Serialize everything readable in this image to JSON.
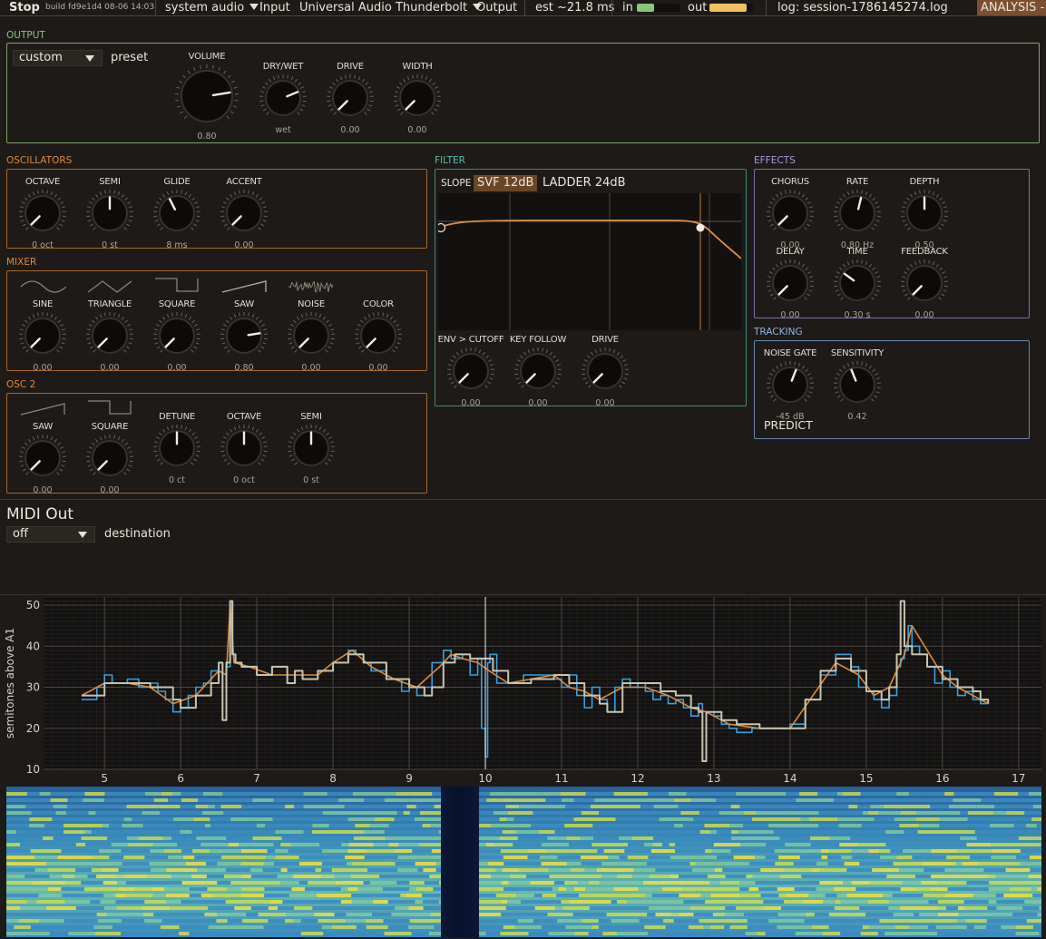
{
  "topbar": {
    "stop_label": "Stop",
    "build_text": "build fd9e1d4 08-06 14:03",
    "audio_source": "system audio",
    "input_label": "Input",
    "input_device": "Universal Audio Thunderbolt",
    "output_label": "Output",
    "latency": "est ~21.8 ms",
    "in_label": "in",
    "in_level": 0.4,
    "out_label": "out",
    "out_level": 0.85,
    "log_text": "log: session-1786145274.log",
    "analysis_label": "ANALYSIS -"
  },
  "colors": {
    "output_accent": "#8cc47c",
    "synth_accent": "#e08a3c",
    "filter_accent": "#4ec0b0",
    "effects_accent": "#a89ae0",
    "tracking_accent": "#8eb4e4",
    "pitch_raw": "#3aa0e0",
    "pitch_smooth": "#e08a3c",
    "pitch_quant": "#c8c4b0"
  },
  "output": {
    "title": "OUTPUT",
    "preset_value": "custom",
    "preset_label": "preset",
    "knobs": [
      {
        "label": "VOLUME",
        "value": "0.80",
        "level": 0.8
      },
      {
        "label": "DRY/WET",
        "value": "wet",
        "level": 0.75
      },
      {
        "label": "DRIVE",
        "value": "0.00",
        "level": 0.0
      },
      {
        "label": "WIDTH",
        "value": "0.00",
        "level": 0.0
      }
    ]
  },
  "oscillators": {
    "title": "OSCILLATORS",
    "knobs": [
      {
        "label": "OCTAVE",
        "value": "0 oct",
        "level": 0.0
      },
      {
        "label": "SEMI",
        "value": "0 st",
        "level": 0.5
      },
      {
        "label": "GLIDE",
        "value": "8 ms",
        "level": 0.4
      },
      {
        "label": "ACCENT",
        "value": "0.00",
        "level": 0.0
      }
    ]
  },
  "mixer": {
    "title": "MIXER",
    "knobs": [
      {
        "label": "SINE",
        "value": "0.00",
        "level": 0.0
      },
      {
        "label": "TRIANGLE",
        "value": "0.00",
        "level": 0.0
      },
      {
        "label": "SQUARE",
        "value": "0.00",
        "level": 0.0
      },
      {
        "label": "SAW",
        "value": "0.80",
        "level": 0.8
      },
      {
        "label": "NOISE",
        "value": "0.00",
        "level": 0.0
      },
      {
        "label": "COLOR",
        "value": "0.00",
        "level": 0.0
      }
    ]
  },
  "osc2": {
    "title": "OSC 2",
    "knobs": [
      {
        "label": "SAW",
        "value": "0.00",
        "level": 0.0
      },
      {
        "label": "SQUARE",
        "value": "0.00",
        "level": 0.0
      },
      {
        "label": "DETUNE",
        "value": "0 ct",
        "level": 0.5
      },
      {
        "label": "OCTAVE",
        "value": "0 oct",
        "level": 0.5
      },
      {
        "label": "SEMI",
        "value": "0 st",
        "level": 0.5
      }
    ]
  },
  "filter": {
    "title": "FILTER",
    "slope_label": "SLOPE",
    "slope_options": [
      "SVF 12dB",
      "LADDER 24dB"
    ],
    "slope_selected": "SVF 12dB",
    "knobs": [
      {
        "label": "ENV > CUTOFF",
        "value": "0.00",
        "level": 0.0
      },
      {
        "label": "KEY FOLLOW",
        "value": "0.00",
        "level": 0.0
      },
      {
        "label": "DRIVE",
        "value": "0.00",
        "level": 0.0
      }
    ]
  },
  "effects": {
    "title": "EFFECTS",
    "knobs": [
      {
        "label": "CHORUS",
        "value": "0.00",
        "level": 0.0
      },
      {
        "label": "RATE",
        "value": "0.80 Hz",
        "level": 0.55
      },
      {
        "label": "DEPTH",
        "value": "0.50",
        "level": 0.5
      },
      {
        "label": "DELAY",
        "value": "0.00",
        "level": 0.0
      },
      {
        "label": "TIME",
        "value": "0.30 s",
        "level": 0.3
      },
      {
        "label": "FEEDBACK",
        "value": "0.00",
        "level": 0.0
      }
    ]
  },
  "tracking": {
    "title": "TRACKING",
    "knobs": [
      {
        "label": "NOISE GATE",
        "value": "-45 dB",
        "level": 0.58
      },
      {
        "label": "SENSITIVITY",
        "value": "0.42",
        "level": 0.42
      }
    ],
    "predict_label": "PREDICT"
  },
  "midi": {
    "title": "MIDI Out",
    "value": "off",
    "dest_label": "destination"
  },
  "chart_data": {
    "type": "line",
    "ylabel": "semitones above A1",
    "xlabel": "",
    "xlim": [
      4.2,
      17.3
    ],
    "ylim": [
      10,
      52
    ],
    "xticks": [
      5,
      6,
      7,
      8,
      9,
      10,
      11,
      12,
      13,
      14,
      15,
      16,
      17
    ],
    "yticks": [
      10,
      20,
      30,
      40,
      50
    ],
    "grid": true,
    "cursor_x": 10.0,
    "series": [
      {
        "color": "#3aa0e0",
        "x": [
          4.7,
          4.9,
          5.0,
          5.1,
          5.3,
          5.45,
          5.6,
          5.7,
          5.8,
          5.9,
          6.0,
          6.1,
          6.2,
          6.3,
          6.4,
          6.5,
          6.55,
          6.6,
          6.65,
          6.68,
          6.72,
          6.8,
          7.0,
          7.2,
          7.4,
          7.5,
          7.6,
          7.8,
          8.0,
          8.2,
          8.3,
          8.4,
          8.5,
          8.7,
          8.9,
          9.0,
          9.1,
          9.2,
          9.3,
          9.45,
          9.55,
          9.7,
          9.8,
          9.9,
          9.95,
          10.0,
          10.03,
          10.06,
          10.15,
          10.3,
          10.5,
          10.7,
          10.9,
          11.0,
          11.1,
          11.2,
          11.3,
          11.4,
          11.5,
          11.6,
          11.7,
          11.8,
          11.9,
          12.0,
          12.1,
          12.2,
          12.3,
          12.4,
          12.5,
          12.6,
          12.7,
          12.8,
          12.85,
          12.9,
          13.0,
          13.1,
          13.2,
          13.3,
          13.5,
          13.7,
          13.9,
          14.0,
          14.2,
          14.4,
          14.6,
          14.8,
          14.9,
          15.0,
          15.1,
          15.2,
          15.3,
          15.4,
          15.45,
          15.5,
          15.55,
          15.6,
          15.7,
          15.8,
          15.9,
          16.0,
          16.1,
          16.2,
          16.3,
          16.4,
          16.5,
          16.6
        ],
        "y": [
          27,
          30,
          33,
          31,
          32,
          30,
          31,
          29,
          27,
          24,
          25,
          28,
          30,
          31,
          34,
          36,
          22,
          35,
          51,
          38,
          36,
          35,
          33,
          35,
          31,
          34,
          32,
          34,
          36,
          39,
          38,
          36,
          34,
          32,
          29,
          30,
          28,
          30,
          36,
          39,
          37,
          38,
          33,
          37,
          20,
          13,
          36,
          38,
          31,
          31,
          33,
          33,
          32,
          30,
          33,
          28,
          25,
          30,
          27,
          24,
          30,
          32,
          30,
          31,
          29,
          27,
          28,
          26,
          27,
          25,
          23,
          26,
          12,
          24,
          23,
          21,
          20,
          19,
          20,
          20,
          20,
          21,
          27,
          33,
          38,
          35,
          30,
          29,
          27,
          25,
          28,
          35,
          37,
          39,
          45,
          40,
          38,
          35,
          31,
          34,
          30,
          28,
          29,
          27,
          26,
          26
        ]
      },
      {
        "color": "#e08a3c",
        "x": [
          4.7,
          5.0,
          5.3,
          5.6,
          5.9,
          6.2,
          6.5,
          6.6,
          6.65,
          6.7,
          6.9,
          7.2,
          7.5,
          7.8,
          8.0,
          8.25,
          8.5,
          8.8,
          9.1,
          9.4,
          9.55,
          9.7,
          9.9,
          10.05,
          10.3,
          10.6,
          10.9,
          11.1,
          11.3,
          11.5,
          11.8,
          12.1,
          12.4,
          12.7,
          12.9,
          13.2,
          13.6,
          14.0,
          14.3,
          14.6,
          14.9,
          15.1,
          15.3,
          15.5,
          15.6,
          15.8,
          16.0,
          16.2,
          16.4,
          16.6
        ],
        "y": [
          28,
          31,
          31,
          30,
          26,
          28,
          34,
          33,
          50,
          36,
          35,
          33,
          33,
          33,
          36,
          39,
          35,
          32,
          30,
          35,
          38,
          37,
          36,
          34,
          31,
          32,
          33,
          30,
          29,
          27,
          30,
          30,
          28,
          25,
          24,
          21,
          20,
          20,
          28,
          36,
          33,
          28,
          30,
          38,
          45,
          39,
          33,
          30,
          28,
          26
        ]
      },
      {
        "color": "#c8c4b0",
        "x": [
          4.7,
          5.0,
          5.3,
          5.6,
          5.9,
          6.0,
          6.2,
          6.4,
          6.5,
          6.52,
          6.55,
          6.6,
          6.65,
          6.68,
          6.72,
          6.8,
          7.0,
          7.2,
          7.4,
          7.5,
          7.6,
          7.8,
          8.0,
          8.2,
          8.4,
          8.7,
          9.0,
          9.2,
          9.3,
          9.45,
          9.6,
          9.7,
          9.8,
          9.95,
          10.0,
          10.1,
          10.3,
          10.6,
          10.9,
          11.1,
          11.3,
          11.5,
          11.6,
          11.8,
          12.0,
          12.3,
          12.5,
          12.7,
          12.8,
          12.85,
          12.9,
          13.1,
          13.3,
          13.6,
          13.9,
          14.0,
          14.2,
          14.4,
          14.6,
          14.8,
          15.0,
          15.2,
          15.3,
          15.4,
          15.45,
          15.5,
          15.6,
          15.8,
          16.0,
          16.2,
          16.4,
          16.5,
          16.6
        ],
        "y": [
          28,
          31,
          31,
          30,
          27,
          25,
          28,
          31,
          36,
          36,
          22,
          36,
          51,
          38,
          36,
          35,
          33,
          35,
          31,
          34,
          32,
          34,
          36,
          38,
          36,
          32,
          30,
          28,
          30,
          36,
          38,
          38,
          37,
          37,
          37,
          34,
          31,
          32,
          33,
          31,
          28,
          26,
          24,
          31,
          31,
          29,
          28,
          25,
          24,
          12,
          24,
          22,
          21,
          20,
          20,
          20,
          27,
          34,
          37,
          34,
          29,
          27,
          30,
          38,
          51,
          40,
          38,
          35,
          32,
          30,
          29,
          27,
          26
        ]
      }
    ]
  }
}
